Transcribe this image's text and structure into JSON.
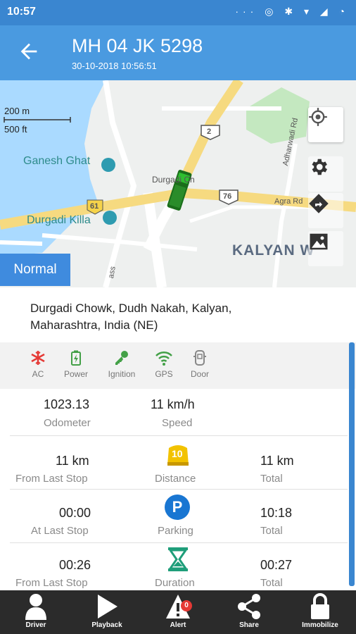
{
  "statusbar": {
    "time": "10:57"
  },
  "header": {
    "vehicle_number": "MH 04 JK 5298",
    "timestamp": "30-10-2018 10:56:51"
  },
  "map": {
    "scale_top": "200 m",
    "scale_bottom": "500 ft",
    "place_1": "Ganesh Ghat",
    "place_2": "Durgadi Killa",
    "place_3": "Durgadi Ch",
    "area_label": "KALYAN W",
    "road_agra": "Agra Rd",
    "road_adharwadi": "Adharwadi Rd",
    "road_shield_2": "2",
    "road_shield_61": "61",
    "road_shield_76": "76",
    "road_pass": "ass",
    "mode_button": "Normal"
  },
  "address": {
    "line1": "Durgadi Chowk,  Dudh Nakah,  Kalyan,",
    "line2": "Maharashtra,  India (NE)"
  },
  "sensors": [
    {
      "label": "AC",
      "icon": "snowflake-icon",
      "color": "#e53935"
    },
    {
      "label": "Power",
      "icon": "battery-icon",
      "color": "#43a047"
    },
    {
      "label": "Ignition",
      "icon": "key-icon",
      "color": "#43a047"
    },
    {
      "label": "GPS",
      "icon": "wifi-icon",
      "color": "#43a047"
    },
    {
      "label": "Door",
      "icon": "door-icon",
      "color": "#888888"
    }
  ],
  "stats": {
    "odometer": {
      "value": "1023.13",
      "label": "Odometer"
    },
    "speed": {
      "value": "11 km/h",
      "label": "Speed"
    },
    "distance": {
      "from_last_stop": {
        "value": "11 km",
        "label": "From Last Stop"
      },
      "icon_value": "10",
      "label": "Distance",
      "total": {
        "value": "11 km",
        "label": "Total"
      }
    },
    "parking": {
      "at_last_stop": {
        "value": "00:00",
        "label": "At Last Stop"
      },
      "icon_letter": "P",
      "label": "Parking",
      "total": {
        "value": "10:18",
        "label": "Total"
      }
    },
    "duration": {
      "from_last_stop": {
        "value": "00:26",
        "label": "From Last Stop"
      },
      "label": "Duration",
      "total": {
        "value": "00:27",
        "label": "Total"
      }
    }
  },
  "bottom_nav": [
    {
      "label": "Driver",
      "icon": "person-icon"
    },
    {
      "label": "Playback",
      "icon": "play-icon"
    },
    {
      "label": "Alert",
      "icon": "alert-icon",
      "badge": "0"
    },
    {
      "label": "Share",
      "icon": "share-icon"
    },
    {
      "label": "Immobilize",
      "icon": "lock-icon"
    }
  ],
  "colors": {
    "primary": "#4a9ae0",
    "status_bar": "#3a86d0",
    "green": "#43a047",
    "red": "#e53935",
    "nav_bg": "#2b2b2b"
  }
}
